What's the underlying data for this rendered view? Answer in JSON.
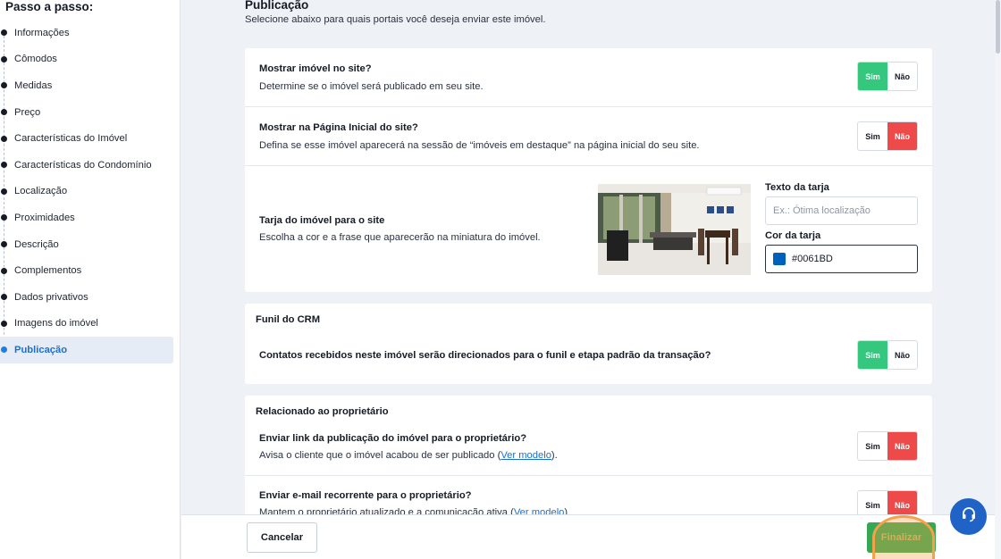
{
  "sidebar": {
    "title": "Passo a passo:",
    "steps": [
      {
        "label": "Informações"
      },
      {
        "label": "Cômodos"
      },
      {
        "label": "Medidas"
      },
      {
        "label": "Preço"
      },
      {
        "label": "Características do Imóvel"
      },
      {
        "label": "Características do Condomínio"
      },
      {
        "label": "Localização"
      },
      {
        "label": "Proximidades"
      },
      {
        "label": "Descrição"
      },
      {
        "label": "Complementos"
      },
      {
        "label": "Dados privativos"
      },
      {
        "label": "Imagens do imóvel"
      },
      {
        "label": "Publicação",
        "active": true
      }
    ]
  },
  "section": {
    "title": "Publicação",
    "subtitle": "Selecione abaixo para quais portais você deseja enviar este imóvel."
  },
  "site": {
    "show_on_site": {
      "title": "Mostrar imóvel no site?",
      "desc": "Determine se o imóvel será publicado em seu site.",
      "value": "Sim"
    },
    "show_on_home": {
      "title": "Mostrar na Página Inicial do site?",
      "desc": "Defina se esse imóvel aparecerá na sessão de “imóveis em destaque” na página inicial do seu site.",
      "value": "Não"
    },
    "banner": {
      "title": "Tarja do imóvel para o site",
      "desc": "Escolha a cor e a frase que aparecerão na miniatura do imóvel.",
      "text_label": "Texto da tarja",
      "text_placeholder": "Ex.: Ótima localização",
      "color_label": "Cor da tarja",
      "color_value": "#0061BD"
    }
  },
  "crm": {
    "heading": "Funil do CRM",
    "question": "Contatos recebidos neste imóvel serão direcionados para o funil e etapa padrão da transação?",
    "value": "Sim"
  },
  "owner": {
    "heading": "Relacionado ao proprietário",
    "send_link": {
      "title": "Enviar link da publicação do imóvel para o proprietário?",
      "desc_before": "Avisa o cliente que o imóvel acabou de ser publicado (",
      "link": "Ver modelo",
      "desc_after": ").",
      "value": "Não"
    },
    "recurring_email": {
      "title": "Enviar e-mail recorrente para o proprietário?",
      "desc_before": "Mantem o proprietário atualizado e a comunicação ativa (",
      "link": "Ver modelo",
      "desc_after": ")",
      "value": "Não"
    }
  },
  "toggle": {
    "yes": "Sim",
    "no": "Não"
  },
  "footer": {
    "cancel": "Cancelar",
    "finish": "Finalizar"
  },
  "icons": {
    "help": "headset-icon"
  },
  "colors": {
    "green": "#35c77e",
    "red": "#ef4a4a",
    "blue": "#0061BD",
    "accent": "#1c6fd1"
  }
}
